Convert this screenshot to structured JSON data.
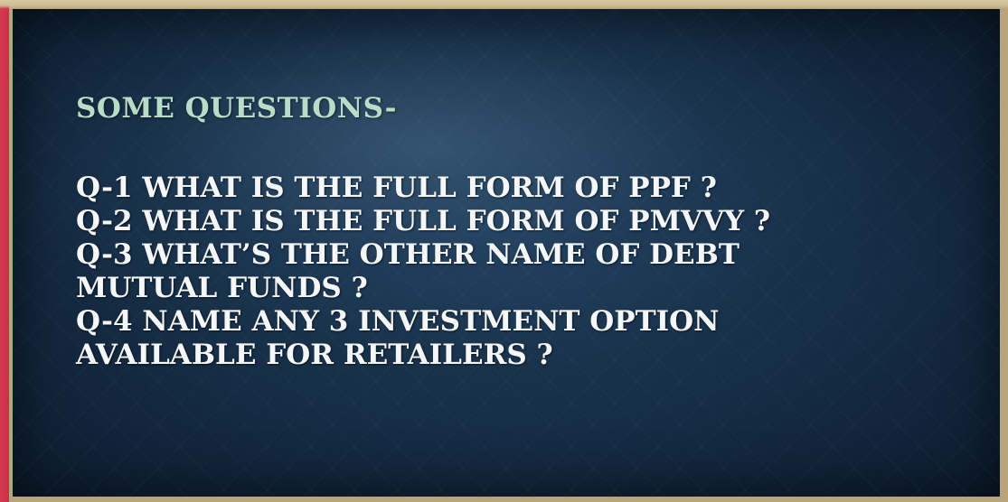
{
  "slide": {
    "heading": "SOME QUESTIONS-",
    "questions": [
      {
        "line1": "Q-1 WHAT IS THE FULL FORM OF PPF ?",
        "line2": ""
      },
      {
        "line1": "Q-2 WHAT IS THE FULL FORM OF PMVVY ?",
        "line2": ""
      },
      {
        "line1": "Q-3 WHAT’S THE OTHER NAME OF DEBT",
        "line2": "MUTUAL FUNDS ?"
      },
      {
        "line1": "Q-4 NAME ANY 3 INVESTMENT OPTION",
        "line2": "AVAILABLE FOR RETAILERS ?"
      }
    ]
  },
  "colors": {
    "heading": "#b9dcc8",
    "text": "#f4f6f8",
    "background": "#152c44",
    "border": "#c93a4e"
  }
}
